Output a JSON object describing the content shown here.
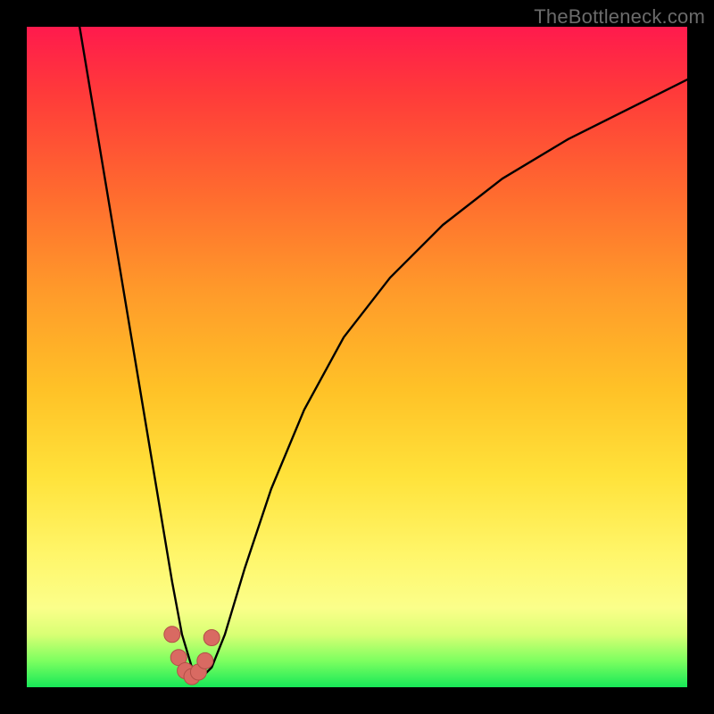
{
  "watermark": "TheBottleneck.com",
  "chart_data": {
    "type": "line",
    "title": "",
    "xlabel": "",
    "ylabel": "",
    "xlim": [
      0,
      100
    ],
    "ylim": [
      0,
      100
    ],
    "series": [
      {
        "name": "bottleneck-curve",
        "x": [
          8,
          10,
          12,
          14,
          16,
          18,
          20,
          22,
          23.5,
          25,
          26.5,
          28,
          30,
          33,
          37,
          42,
          48,
          55,
          63,
          72,
          82,
          92,
          100
        ],
        "values": [
          100,
          88,
          76,
          64,
          52,
          40,
          28,
          16,
          8,
          3,
          1.5,
          3,
          8,
          18,
          30,
          42,
          53,
          62,
          70,
          77,
          83,
          88,
          92
        ]
      }
    ],
    "markers": {
      "name": "minimum-region",
      "x": [
        22.0,
        23.0,
        24.0,
        25.0,
        26.0,
        27.0,
        28.0
      ],
      "values": [
        8.0,
        4.5,
        2.5,
        1.6,
        2.3,
        4.0,
        7.5
      ]
    },
    "colors": {
      "curve": "#000000",
      "marker_fill": "#d96a62",
      "marker_stroke": "#b24f47"
    }
  }
}
